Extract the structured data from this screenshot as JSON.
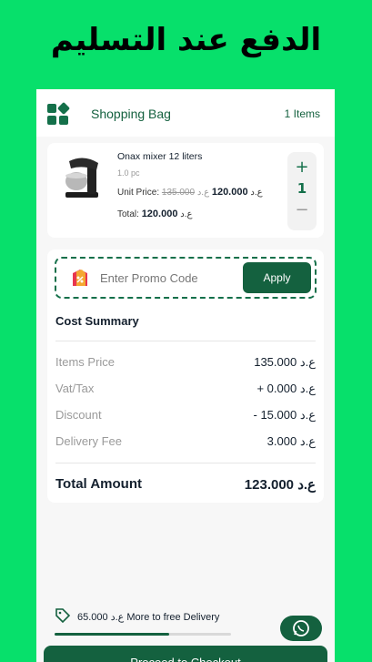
{
  "banner": {
    "text": "الدفع عند التسليم"
  },
  "header": {
    "title": "Shopping Bag",
    "items_count": "1 Items"
  },
  "product": {
    "name": "Onax mixer 12 liters",
    "quantity_unit": "1.0 pc",
    "unit_price_label": "Unit Price:",
    "old_price": "135.000",
    "new_price": "120.000",
    "currency": "ع.د",
    "total_label": "Total:",
    "total_value": "120.000",
    "stepper": {
      "plus": "+",
      "qty": "1",
      "minus": "−"
    }
  },
  "promo": {
    "placeholder": "Enter Promo Code",
    "apply_label": "Apply"
  },
  "cost_summary": {
    "title": "Cost Summary",
    "rows": [
      {
        "label": "Items Price",
        "value": "135.000 ع.د"
      },
      {
        "label": "Vat/Tax",
        "value": "+ 0.000 ع.د"
      },
      {
        "label": "Discount",
        "value": "- 15.000 ع.د"
      },
      {
        "label": "Delivery Fee",
        "value": "3.000 ع.د"
      }
    ],
    "total": {
      "label": "Total Amount",
      "value": "123.000 ع.د"
    }
  },
  "free_delivery": {
    "amount": "65.000",
    "currency": "ع.د",
    "text": "More to free Delivery",
    "progress": 0.65
  },
  "checkout": {
    "label": "Proceed to Checkout"
  },
  "colors": {
    "background": "#07e06b",
    "accent": "#14613f",
    "surface": "#ffffff"
  }
}
